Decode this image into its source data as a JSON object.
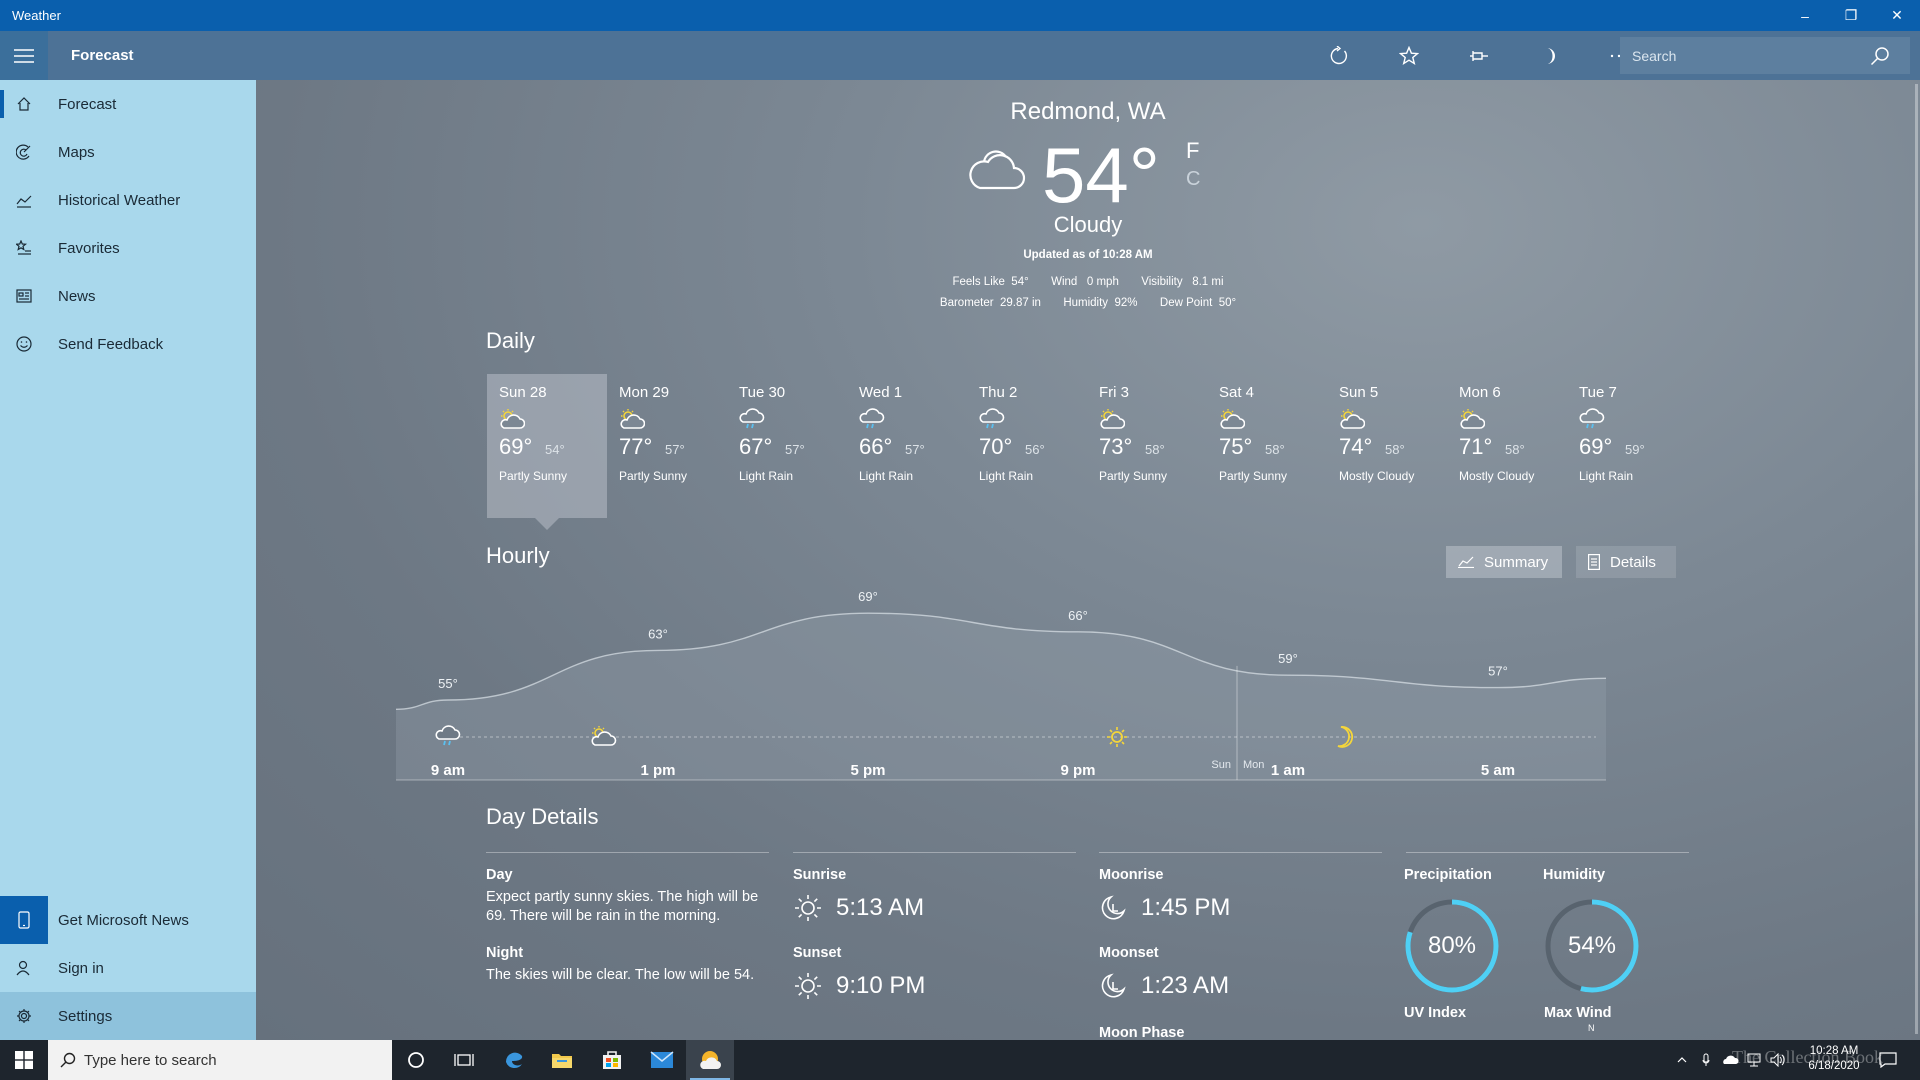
{
  "window": {
    "title": "Weather",
    "minimize": "–",
    "restore": "❐",
    "close": "✕"
  },
  "header": {
    "title": "Forecast",
    "search_placeholder": "Search"
  },
  "sidebar": {
    "items": [
      {
        "label": "Forecast"
      },
      {
        "label": "Maps"
      },
      {
        "label": "Historical Weather"
      },
      {
        "label": "Favorites"
      },
      {
        "label": "News"
      },
      {
        "label": "Send Feedback"
      }
    ],
    "bottom": [
      {
        "label": "Get Microsoft News"
      },
      {
        "label": "Sign in"
      },
      {
        "label": "Settings"
      }
    ]
  },
  "current": {
    "location": "Redmond, WA",
    "temp": "54°",
    "unit_f": "F",
    "unit_c": "C",
    "condition": "Cloudy",
    "updated": "Updated as of 10:28 AM",
    "feels_like_label": "Feels Like",
    "feels_like": "54°",
    "wind_label": "Wind",
    "wind": "0 mph",
    "visibility_label": "Visibility",
    "visibility": "8.1 mi",
    "barometer_label": "Barometer",
    "barometer": "29.87 in",
    "humidity_label": "Humidity",
    "humidity": "92%",
    "dew_point_label": "Dew Point",
    "dew_point": "50°"
  },
  "daily": {
    "title": "Daily",
    "days": [
      {
        "name": "Sun 28",
        "high": "69°",
        "low": "54°",
        "cond": "Partly Sunny",
        "icon": "partly-sunny"
      },
      {
        "name": "Mon 29",
        "high": "77°",
        "low": "57°",
        "cond": "Partly Sunny",
        "icon": "partly-sunny"
      },
      {
        "name": "Tue 30",
        "high": "67°",
        "low": "57°",
        "cond": "Light Rain",
        "icon": "rain"
      },
      {
        "name": "Wed 1",
        "high": "66°",
        "low": "57°",
        "cond": "Light Rain",
        "icon": "rain"
      },
      {
        "name": "Thu 2",
        "high": "70°",
        "low": "56°",
        "cond": "Light Rain",
        "icon": "rain"
      },
      {
        "name": "Fri 3",
        "high": "73°",
        "low": "58°",
        "cond": "Partly Sunny",
        "icon": "partly-sunny"
      },
      {
        "name": "Sat 4",
        "high": "75°",
        "low": "58°",
        "cond": "Partly Sunny",
        "icon": "partly-sunny"
      },
      {
        "name": "Sun 5",
        "high": "74°",
        "low": "58°",
        "cond": "Mostly Cloudy",
        "icon": "partly-sunny"
      },
      {
        "name": "Mon 6",
        "high": "71°",
        "low": "58°",
        "cond": "Mostly Cloudy",
        "icon": "partly-sunny"
      },
      {
        "name": "Tue 7",
        "high": "69°",
        "low": "59°",
        "cond": "Light Rain",
        "icon": "rain"
      }
    ]
  },
  "hourly": {
    "title": "Hourly",
    "summary_label": "Summary",
    "details_label": "Details",
    "labels": [
      "9 am",
      "1 pm",
      "5 pm",
      "9 pm",
      "1 am",
      "5 am"
    ],
    "temp_labels": [
      "55°",
      "63°",
      "69°",
      "66°",
      "59°",
      "57°"
    ],
    "day_divider_left": "Sun",
    "day_divider_right": "Mon"
  },
  "chart_data": {
    "type": "line",
    "x": [
      "9 am",
      "1 pm",
      "5 pm",
      "9 pm",
      "1 am",
      "5 am"
    ],
    "series": [
      {
        "values": [
          55,
          63,
          69,
          66,
          59,
          57
        ]
      }
    ],
    "annotations": [
      "Sun",
      "Mon"
    ]
  },
  "day_details": {
    "title": "Day Details",
    "day_label": "Day",
    "day_text": "Expect partly sunny skies. The high will be 69. There will be rain in the morning.",
    "night_label": "Night",
    "night_text": "The skies will be clear. The low will be 54.",
    "sunrise_label": "Sunrise",
    "sunrise": "5:13 AM",
    "sunset_label": "Sunset",
    "sunset": "9:10 PM",
    "moonrise_label": "Moonrise",
    "moonrise": "1:45 PM",
    "moonset_label": "Moonset",
    "moonset": "1:23 AM",
    "moon_phase_label": "Moon Phase",
    "precip_label": "Precipitation",
    "precip": "80%",
    "precip_fraction": 0.8,
    "humidity_label": "Humidity",
    "humidity": "54%",
    "humidity_fraction": 0.54,
    "uv_label": "UV Index",
    "max_wind_label": "Max Wind",
    "max_wind_dir": "N"
  },
  "taskbar": {
    "search_placeholder": "Type here to search",
    "time": "10:28 AM",
    "date": "6/18/2020",
    "watermark": "The Collection Book"
  },
  "colors": {
    "accent": "#0a5fad",
    "sidebar": "#a9d8ec",
    "ring": "#4fd0f5",
    "sun": "#f5d63a"
  }
}
